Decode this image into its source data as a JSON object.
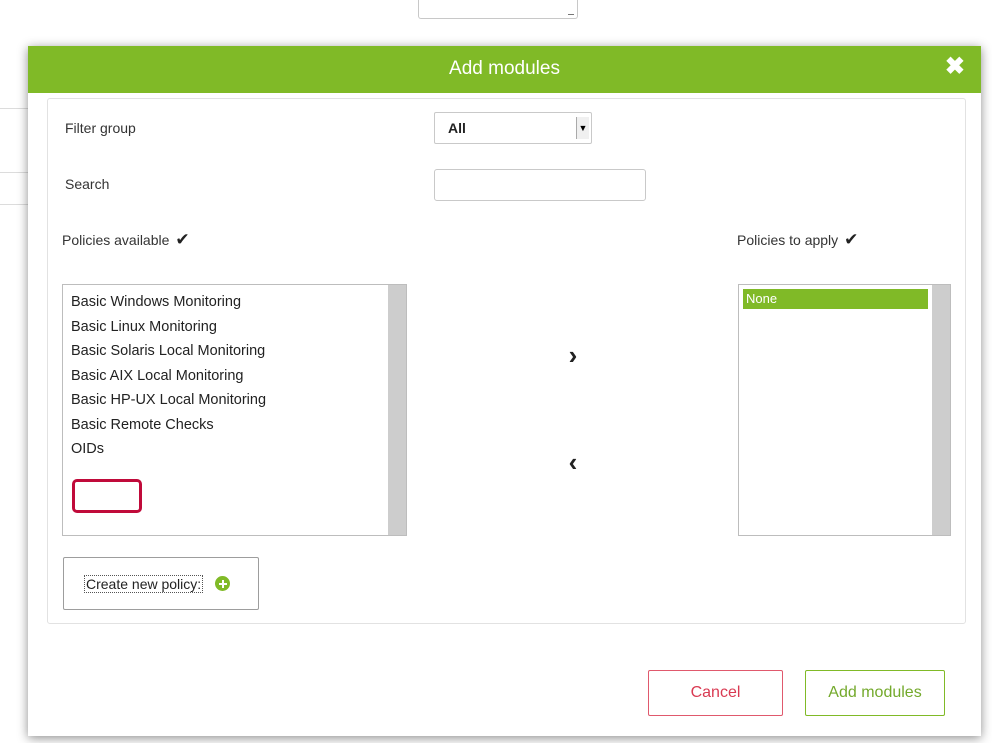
{
  "dialog": {
    "title": "Add modules",
    "close_symbol": "✖"
  },
  "filter": {
    "label": "Filter group",
    "selected": "All"
  },
  "search": {
    "label": "Search",
    "value": "",
    "placeholder": ""
  },
  "available": {
    "label": "Policies available",
    "check_symbol": "✔",
    "items": [
      "Basic Windows Monitoring",
      "Basic Linux Monitoring",
      "Basic Solaris Local Monitoring",
      "Basic AIX Local Monitoring",
      "Basic HP-UX Local Monitoring",
      "Basic Remote Checks",
      "OIDs"
    ]
  },
  "apply": {
    "label": "Policies to apply",
    "check_symbol": "✔",
    "items": [
      "None"
    ]
  },
  "transfer": {
    "add_symbol": "›",
    "remove_symbol": "‹"
  },
  "create_policy": {
    "label": "Create new policy:"
  },
  "buttons": {
    "cancel": "Cancel",
    "add": "Add modules"
  },
  "colors": {
    "accent": "#80ba27",
    "cancel": "#d93a52",
    "highlight": "#c00a3a"
  }
}
